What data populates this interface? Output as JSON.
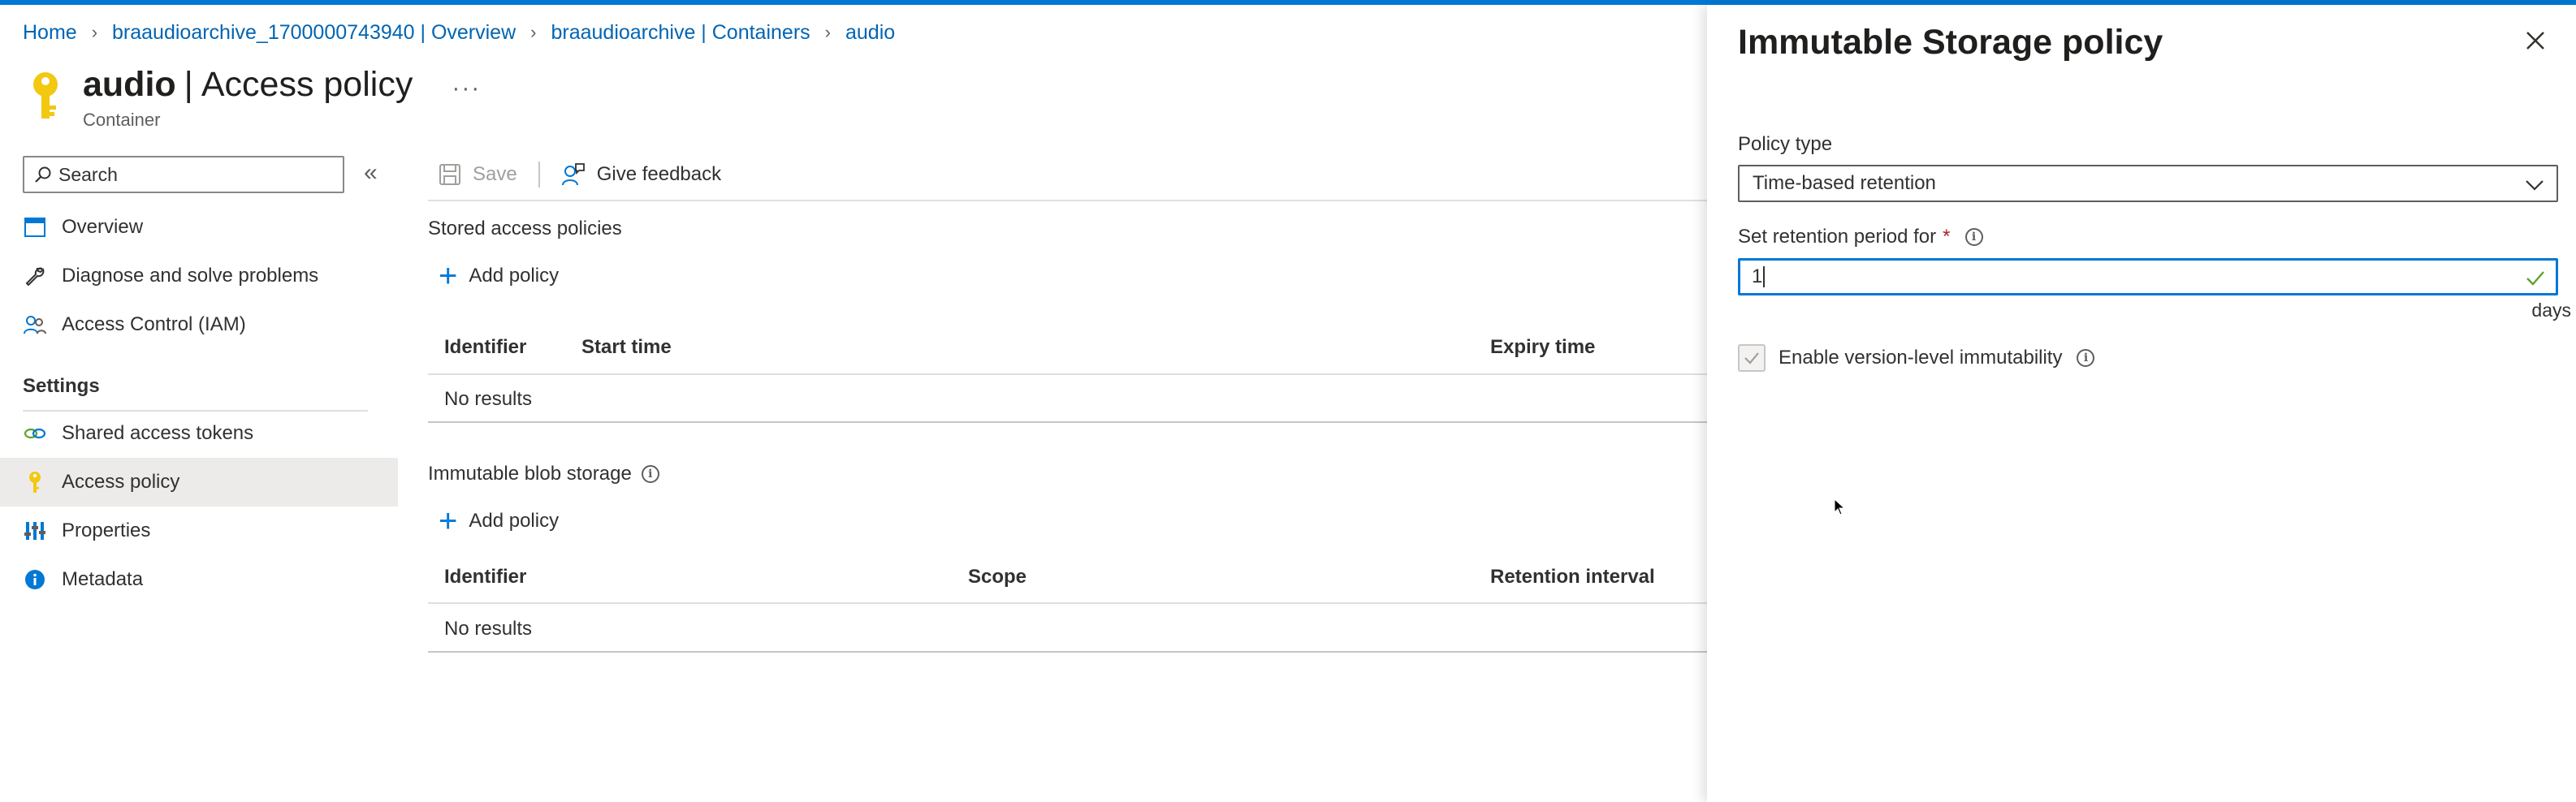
{
  "breadcrumb": [
    "Home",
    "braaudioarchive_1700000743940 | Overview",
    "braaudioarchive | Containers",
    "audio"
  ],
  "header": {
    "title_bold": "audio",
    "title_rest": "Access policy",
    "more": "···",
    "subtitle": "Container"
  },
  "sidebar": {
    "search_placeholder": "Search",
    "collapse": "«",
    "items": [
      {
        "label": "Overview",
        "icon": "overview-icon"
      },
      {
        "label": "Diagnose and solve problems",
        "icon": "wrench-icon"
      },
      {
        "label": "Access Control (IAM)",
        "icon": "people-icon"
      }
    ],
    "settings_heading": "Settings",
    "settings_items": [
      {
        "label": "Shared access tokens",
        "icon": "link-icon"
      },
      {
        "label": "Access policy",
        "icon": "key-icon",
        "selected": true
      },
      {
        "label": "Properties",
        "icon": "properties-icon"
      },
      {
        "label": "Metadata",
        "icon": "info-icon"
      }
    ]
  },
  "toolbar": {
    "save_label": "Save",
    "feedback_label": "Give feedback"
  },
  "stored_policies": {
    "heading": "Stored access policies",
    "add_label": "Add policy",
    "columns": [
      "Identifier",
      "Start time",
      "Expiry time"
    ],
    "empty": "No results"
  },
  "immutable_storage": {
    "heading": "Immutable blob storage",
    "add_label": "Add policy",
    "columns": [
      "Identifier",
      "Scope",
      "Retention interval"
    ],
    "empty": "No results"
  },
  "panel": {
    "title": "Immutable Storage policy",
    "policy_type_label": "Policy type",
    "policy_type_value": "Time-based retention",
    "retention_label": "Set retention period for",
    "required_mark": "*",
    "retention_value": "1",
    "retention_unit": "days",
    "version_checkbox_label": "Enable version-level immutability",
    "version_checkbox_checked": true
  },
  "colors": {
    "accent": "#0078d4",
    "link": "#0065b3",
    "key_yellow": "#f2c811",
    "required": "#a4262c"
  }
}
